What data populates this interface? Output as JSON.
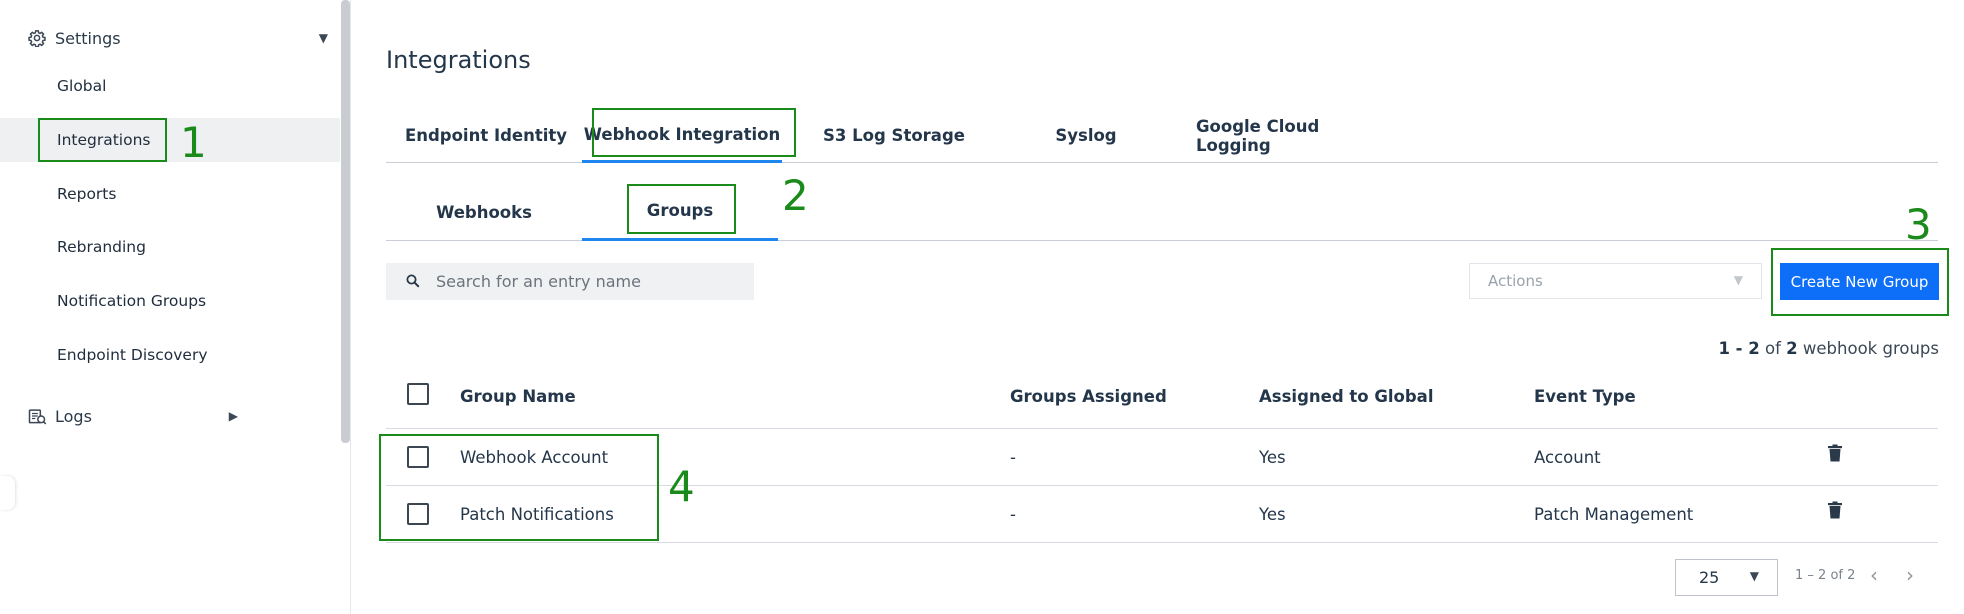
{
  "sidebar": {
    "settings_label": "Settings",
    "settings_icon": "gear-icon",
    "items": [
      {
        "label": "Global"
      },
      {
        "label": "Integrations"
      },
      {
        "label": "Reports"
      },
      {
        "label": "Rebranding"
      },
      {
        "label": "Notification Groups"
      },
      {
        "label": "Endpoint Discovery"
      }
    ],
    "logs_label": "Logs",
    "logs_icon": "logs-icon"
  },
  "main": {
    "title": "Integrations",
    "tabs": [
      {
        "label": "Endpoint Identity"
      },
      {
        "label": "Webhook Integration"
      },
      {
        "label": "S3 Log Storage"
      },
      {
        "label": "Syslog"
      },
      {
        "label": "Google Cloud Logging"
      }
    ],
    "subtabs": [
      {
        "label": "Webhooks"
      },
      {
        "label": "Groups"
      }
    ],
    "search_placeholder": "Search for an entry name",
    "actions_label": "Actions",
    "create_button": "Create New Group",
    "count": {
      "range": "1 - 2",
      "of": "of",
      "total": "2",
      "suffix": "webhook groups"
    },
    "columns": [
      "Group Name",
      "Groups Assigned",
      "Assigned to Global",
      "Event Type"
    ],
    "rows": [
      {
        "name": "Webhook Account",
        "groups_assigned": "-",
        "assigned_global": "Yes",
        "event_type": "Account"
      },
      {
        "name": "Patch Notifications",
        "groups_assigned": "-",
        "assigned_global": "Yes",
        "event_type": "Patch Management"
      }
    ],
    "pagination": {
      "page_size": "25",
      "range": "1 – 2 of 2"
    }
  },
  "annotations": [
    "1",
    "2",
    "3",
    "4"
  ],
  "colors": {
    "accent": "#0d6ef7",
    "annotation": "#1a8a1a",
    "active_tab_underline": "#1f86f0"
  }
}
